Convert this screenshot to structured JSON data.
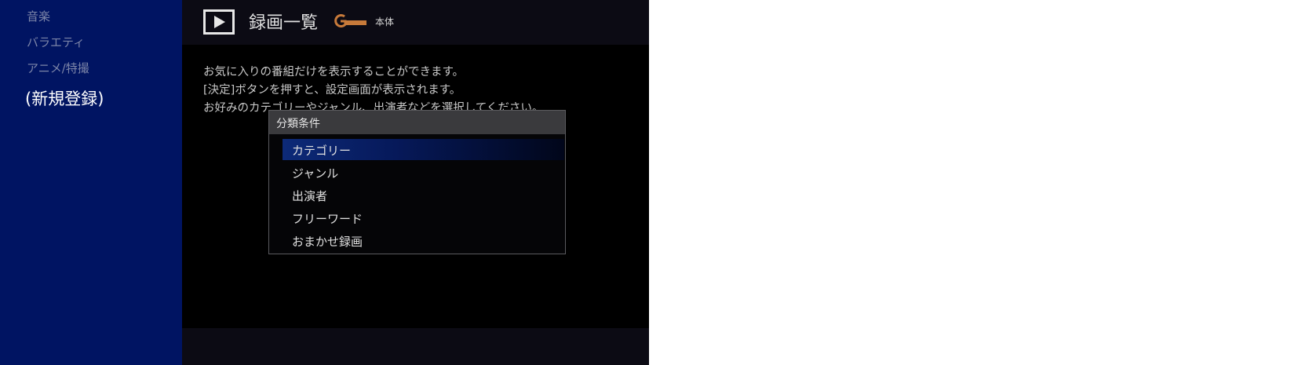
{
  "sidebar": {
    "items": [
      {
        "label": "音楽"
      },
      {
        "label": "バラエティ"
      },
      {
        "label": "アニメ/特撮"
      },
      {
        "label": "(新規登録)"
      }
    ]
  },
  "header": {
    "icon": "play-icon",
    "title": "録画一覧",
    "logo_icon": "g-guide-logo",
    "device": "本体"
  },
  "description": {
    "line1": "お気に入りの番組だけを表示することができます。",
    "line2": "[決定]ボタンを押すと、設定画面が表示されます。",
    "line3": "お好みのカテゴリーやジャンル、出演者などを選択してください。"
  },
  "dialog": {
    "title": "分類条件",
    "options": [
      {
        "label": "カテゴリー"
      },
      {
        "label": "ジャンル"
      },
      {
        "label": "出演者"
      },
      {
        "label": "フリーワード"
      },
      {
        "label": "おまかせ録画"
      }
    ],
    "selected_index": 0
  },
  "colors": {
    "sidebar_bg": "#001462",
    "header_bg": "#0c0b14",
    "selection": "#0d2a78",
    "logo": "#c77a3a"
  }
}
